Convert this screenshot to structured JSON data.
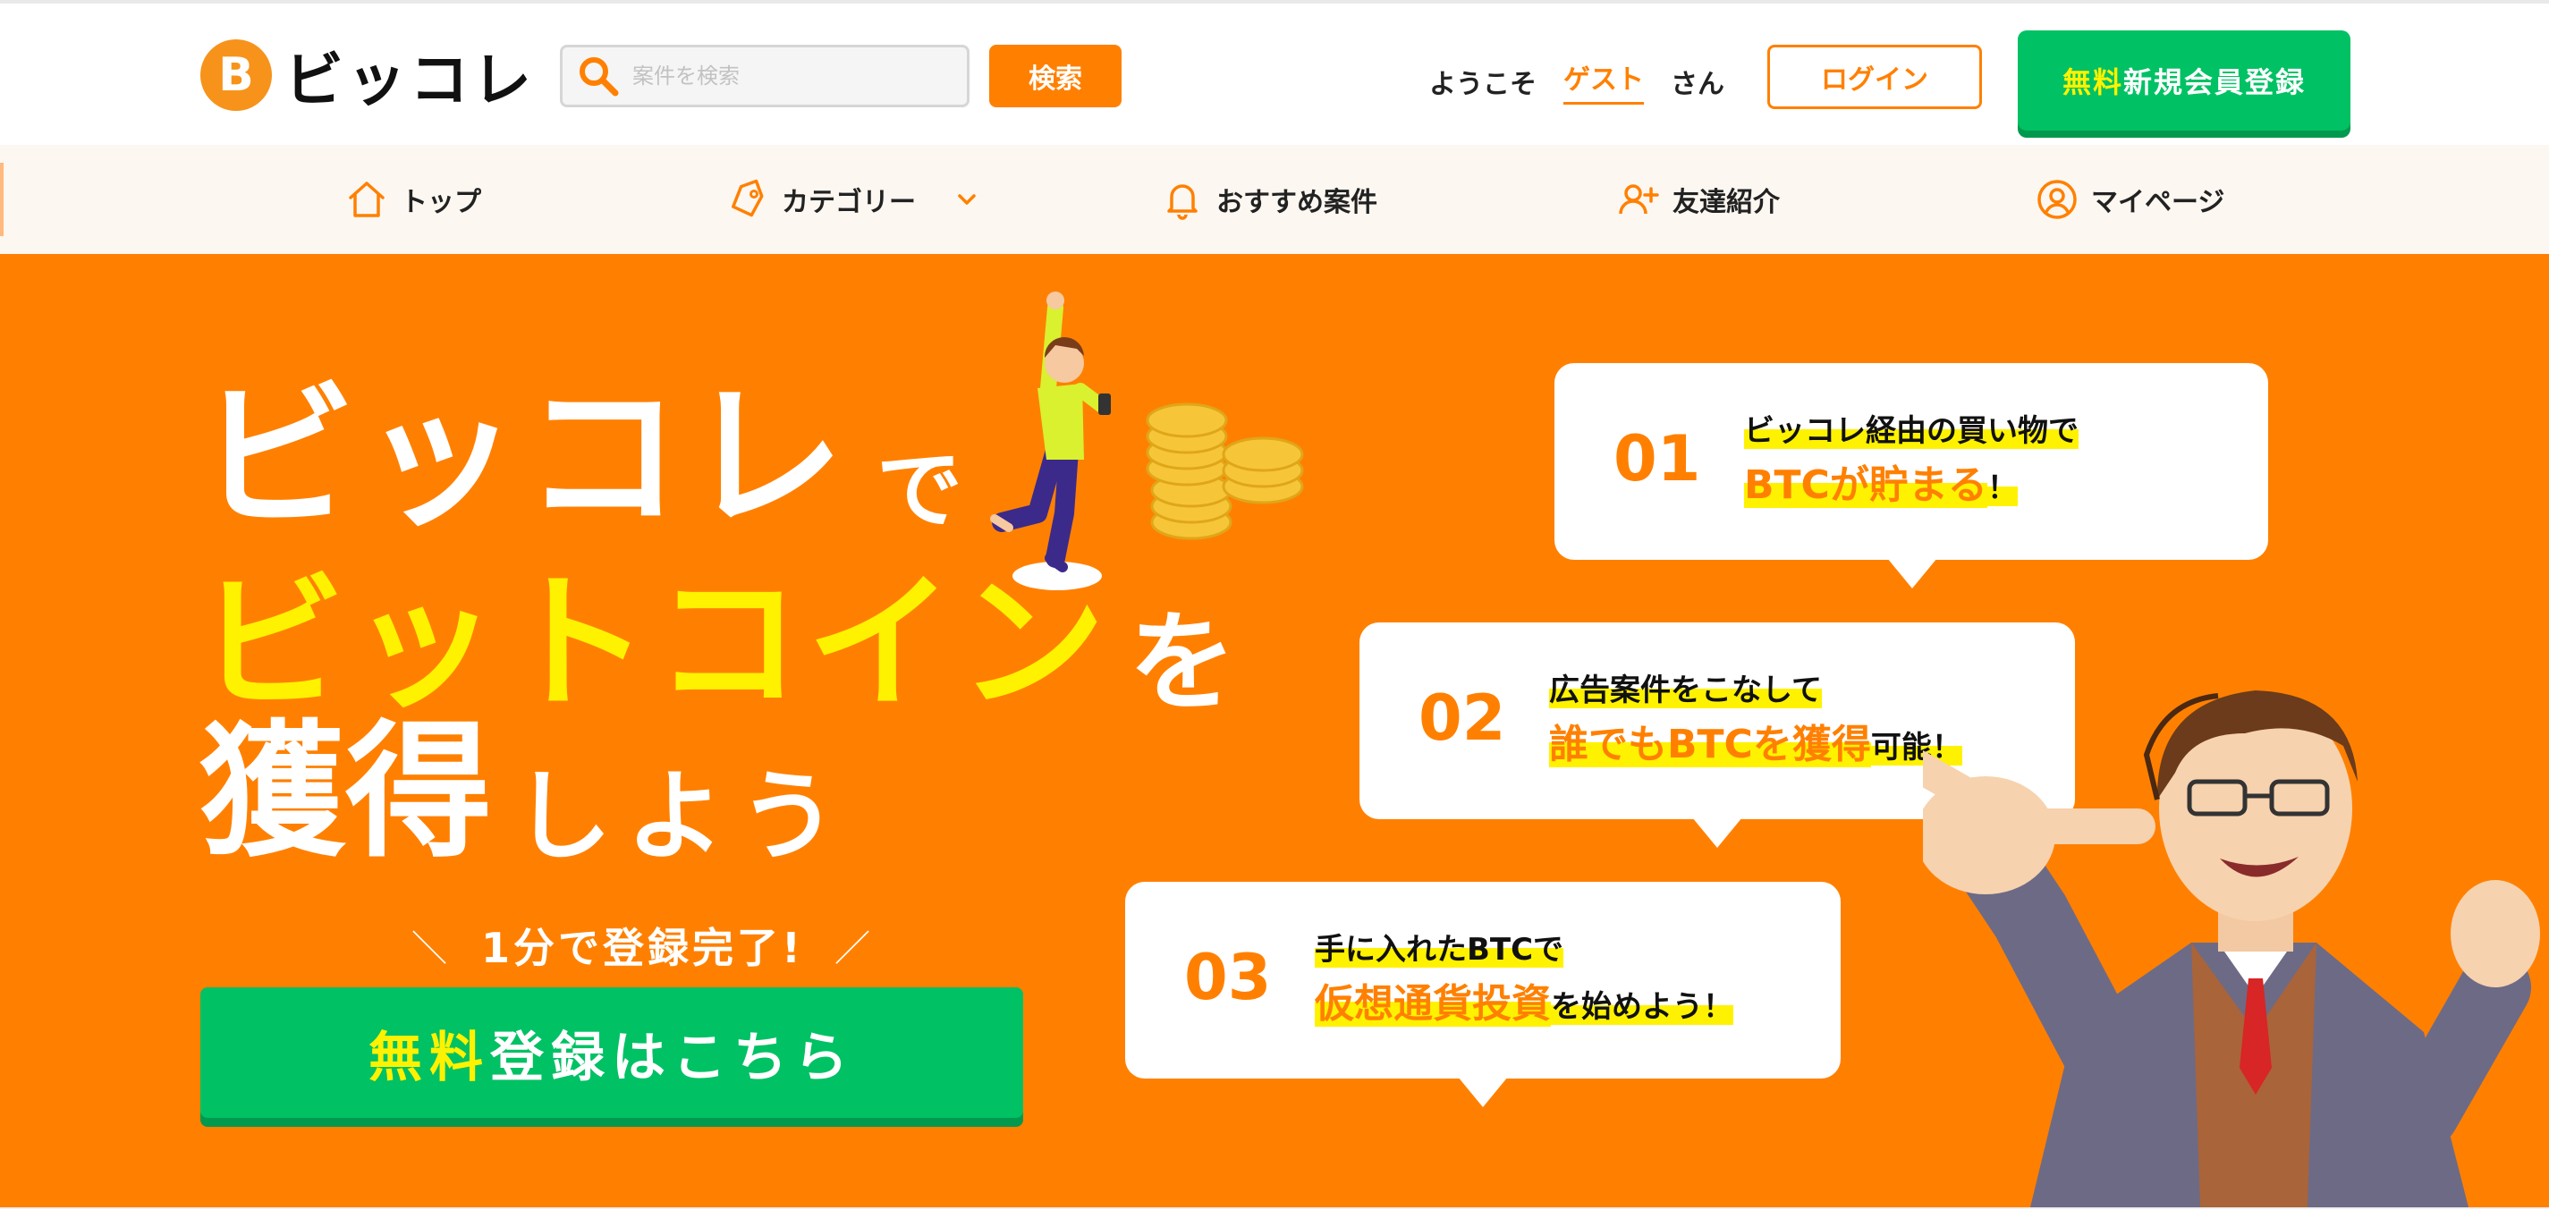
{
  "brand": {
    "name": "ビッコレ",
    "coin_symbol": "B",
    "accent": "#ff8000",
    "green": "#00c164",
    "highlight": "#fff200"
  },
  "header": {
    "search_placeholder": "案件を検索",
    "search_button": "検索",
    "welcome_prefix": "ようこそ",
    "guest": "ゲスト",
    "welcome_suffix": "さん",
    "login": "ログイン",
    "register_highlight": "無料",
    "register_rest": "新規会員登録"
  },
  "nav": {
    "items": [
      {
        "label": "トップ",
        "icon": "home-icon"
      },
      {
        "label": "カテゴリー",
        "icon": "tag-icon"
      },
      {
        "label": "おすすめ案件",
        "icon": "bell-icon"
      },
      {
        "label": "友達紹介",
        "icon": "add-user-icon"
      },
      {
        "label": "マイページ",
        "icon": "user-circle-icon"
      }
    ]
  },
  "hero": {
    "line1_main": "ビッコレ",
    "line1_suffix": "で",
    "line2_main": "ビットコイン",
    "line2_suffix": "を",
    "line3_main": "獲得",
    "line3_suffix": "しよう",
    "tagline": "1分で登録完了!",
    "cta_highlight": "無料",
    "cta_rest": "登録はこちら",
    "bubbles": [
      {
        "num": "01",
        "line1": "ビッコレ経由の買い物で",
        "line2_em": "BTCが貯まる",
        "line2_tail": "！"
      },
      {
        "num": "02",
        "line1": "広告案件をこなして",
        "line2_em": "誰でもBTCを獲得",
        "line2_tail": "可能！"
      },
      {
        "num": "03",
        "line1": "手に入れたBTCで",
        "line2_em": "仮想通貨投資",
        "line2_tail": "を始めよう！"
      }
    ]
  }
}
